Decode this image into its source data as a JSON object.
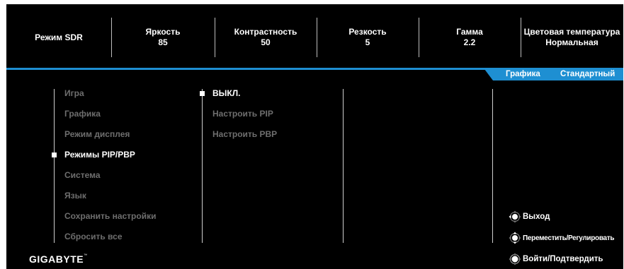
{
  "status_bar": [
    {
      "label": "Режим SDR",
      "value": ""
    },
    {
      "label": "Яркость",
      "value": "85"
    },
    {
      "label": "Контрастность",
      "value": "50"
    },
    {
      "label": "Резкость",
      "value": "5"
    },
    {
      "label": "Гамма",
      "value": "2.2"
    },
    {
      "label": "Цветовая температура",
      "value": "Нормальная"
    }
  ],
  "mode_tab": {
    "picture_mode": "Графика",
    "preset": "Стандартный"
  },
  "main_menu": {
    "items": [
      "Игра",
      "Графика",
      "Режим дисплея",
      "Режимы PIP/PBP",
      "Система",
      "Язык",
      "Сохранить настройки",
      "Сбросить все"
    ],
    "selected": "Режимы PIP/PBP"
  },
  "sub_menu": {
    "items": [
      "ВЫКЛ.",
      "Настроить PIP",
      "Настроить PBP"
    ],
    "selected": "ВЫКЛ."
  },
  "logo": {
    "text": "GIGABYTE",
    "tm": "™"
  },
  "hints": [
    {
      "icon": "joystick-left-icon",
      "label": "Выход"
    },
    {
      "icon": "joystick-updown-icon",
      "label": "Переместить/Регулировать"
    },
    {
      "icon": "joystick-press-icon",
      "label": "Войти/Подтвердить"
    }
  ],
  "colors": {
    "accent": "#1e8fd2",
    "background": "#000000",
    "inactive_text": "#6e6e6e"
  }
}
